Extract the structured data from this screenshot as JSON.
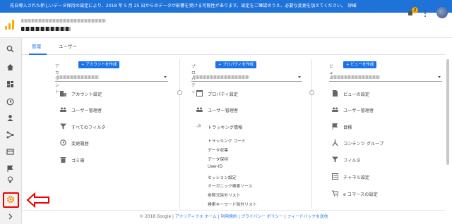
{
  "banner": {
    "text": "先日導入された新しいデータ保持の設定により、2018 年 5 月 25 日からのデータが影響を受ける可能性があります。設定をご確認のうえ、必要な変更を加えてください。",
    "link": "詳細"
  },
  "topbar": {
    "notification_count": "2"
  },
  "tabs": [
    {
      "label": "管理"
    },
    {
      "label": "ユーザー"
    }
  ],
  "account": {
    "label": "アカウント",
    "create": "+ アカウントを作成",
    "items": [
      {
        "label": "アカウント設定"
      },
      {
        "label": "ユーザー管理者"
      },
      {
        "label": "すべてのフィルタ"
      },
      {
        "label": "変更履歴"
      },
      {
        "label": "ゴミ箱"
      }
    ]
  },
  "property": {
    "label": "プロパティ",
    "create": "+ プロパティを作成",
    "items": [
      {
        "label": "プロパティ設定"
      },
      {
        "label": "ユーザー管理者"
      },
      {
        "label": "トラッキング情報"
      }
    ],
    "tracking_prefix": ".js",
    "sub_items": [
      "トラッキング コード",
      "データ収集",
      "データ保持",
      "User-ID",
      "セッション設定",
      "オーガニック検索ソース",
      "参照元除外リスト",
      "検索キーワード除外リスト"
    ]
  },
  "view": {
    "label": "ビュー",
    "create": "+ ビューを作成",
    "items": [
      {
        "label": "ビューの設定"
      },
      {
        "label": "ユーザー管理者"
      },
      {
        "label": "目標"
      },
      {
        "label": "コンテンツ グループ"
      },
      {
        "label": "フィルタ"
      },
      {
        "label": "チャネル設定"
      },
      {
        "label": "e コマースの設定"
      }
    ]
  },
  "footer": {
    "copyright": "© 2018 Google | ",
    "links": [
      "アナリティクス ホーム",
      "利用規約",
      "プライバシー ポリシー",
      "フィードバックを送信"
    ],
    "sep": " | "
  },
  "colors": {
    "accent": "#1a73e8",
    "banner": "#1e72d8",
    "logo": "#f9ab00",
    "highlight": "#e00000"
  }
}
